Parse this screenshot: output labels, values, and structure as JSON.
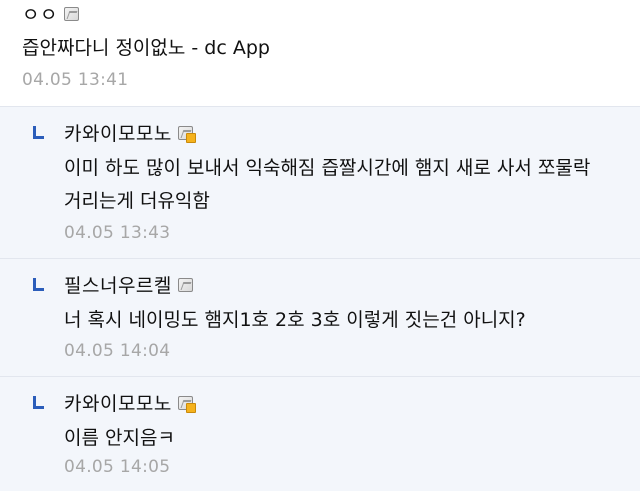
{
  "main_comment": {
    "author": "ㅇㅇ",
    "text": "즙안짜다니 정이없노 - dc App",
    "timestamp": "04.05 13:41"
  },
  "replies": [
    {
      "author": "카와이모모노",
      "text_lines": [
        "이미 하도 많이 보내서 익숙해짐 즙짤시간에 햄지 새로 사서 쪼물락",
        "거리는게 더유익함"
      ],
      "timestamp": "04.05 13:43"
    },
    {
      "author": "필스너우르켈",
      "text_lines": [
        "너 혹시 네이밍도 햄지1호 2호 3호 이렇게 짓는건 아니지?"
      ],
      "timestamp": "04.05 14:04"
    },
    {
      "author": "카와이모모노",
      "text_lines": [
        "이름 안지음ㅋ"
      ],
      "timestamp": "04.05 14:05"
    }
  ],
  "icons": {
    "reply": "reply-arrow-icon",
    "gallog": "gallog-icon"
  },
  "colors": {
    "reply_background": "#f3f6fb",
    "reply_arrow": "#2b5dba",
    "timestamp": "#a7a7a7"
  }
}
